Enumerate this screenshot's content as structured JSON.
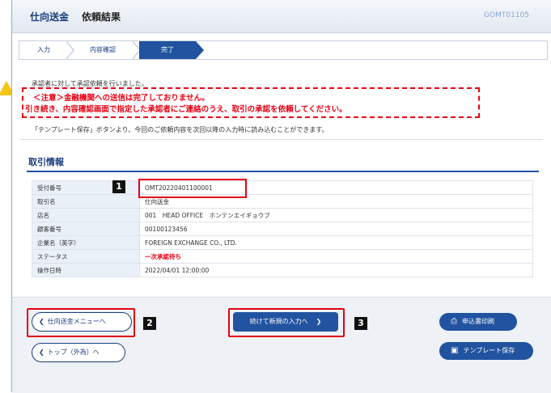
{
  "header": {
    "title": "仕向送金",
    "subtitle": "依頼結果",
    "screen_id": "GOMT01105"
  },
  "steps": [
    {
      "label": "入力"
    },
    {
      "label": "内容確認"
    },
    {
      "label": "完了"
    }
  ],
  "messages": {
    "line1": "承認者に対して承認依頼を行いました。",
    "warning1": "＜注意＞金融機関への送信は完了しておりません。",
    "warning2": "引き続き、内容確認画面で指定した承認者にご連絡のうえ、取引の承認を依頼してください。",
    "template_note": "「テンプレート保存」ボタンより、今回のご依頼内容を次回以降の入力時に読み込むことができます。"
  },
  "section": {
    "title": "取引情報"
  },
  "info_rows": [
    {
      "label": "受付番号",
      "value": "OMT20220401100001"
    },
    {
      "label": "取引名",
      "value": "仕向送金"
    },
    {
      "label": "店名",
      "value": "001　HEAD OFFICE　ホンテンエイギョウブ"
    },
    {
      "label": "顧客番号",
      "value": "00100123456"
    },
    {
      "label": "企業名（英字）",
      "value": "FOREIGN EXCHANGE CO., LTD."
    },
    {
      "label": "ステータス",
      "value": "一次承認待ち"
    },
    {
      "label": "操作日時",
      "value": "2022/04/01 12:00:00"
    }
  ],
  "badges": [
    "1",
    "2",
    "3"
  ],
  "buttons": {
    "menu": "仕向送金メニューへ",
    "top": "トップ（外為）へ",
    "continue": "続けて新規の入力へ",
    "print": "申込書印刷",
    "template_save": "テンプレート保存"
  },
  "colors": {
    "accent": "#2153a0",
    "warning": "#e60012",
    "highlight": "#e60012"
  }
}
